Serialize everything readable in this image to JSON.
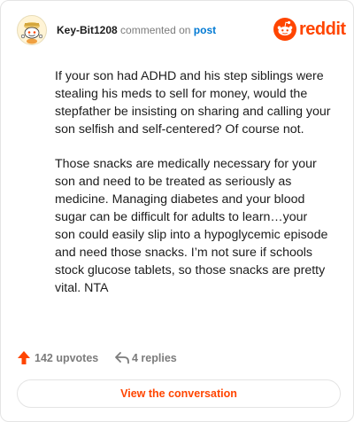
{
  "header": {
    "username": "Key-Bit1208",
    "action": "commented on",
    "post_link": "post",
    "brand_name": "reddit"
  },
  "comment": {
    "paragraphs": [
      "If your son had ADHD and his step siblings were stealing his meds to sell for money, would the stepfather be insisting on sharing and calling your son selfish and self-centered? Of course not.",
      "Those snacks are medically necessary for your son and need to be treated as seriously as medicine. Managing diabetes and your blood sugar can be difficult for adults to learn…your son could easily slip into a hypoglycemic episode and need those snacks. I’m not sure if schools stock glucose tablets, so those snacks are pretty vital. NTA"
    ]
  },
  "stats": {
    "upvotes": "142 upvotes",
    "replies": "4 replies"
  },
  "cta": {
    "label": "View the conversation"
  },
  "colors": {
    "brand": "#ff4500",
    "link": "#0079d3",
    "muted": "#7c7c7c",
    "text": "#1c1c1c",
    "border": "#e4e4e4"
  },
  "icons": {
    "avatar": "snoo-avatar-icon",
    "brand": "reddit-logo-icon",
    "upvote": "upvote-arrow-icon",
    "reply": "reply-arrow-icon"
  }
}
